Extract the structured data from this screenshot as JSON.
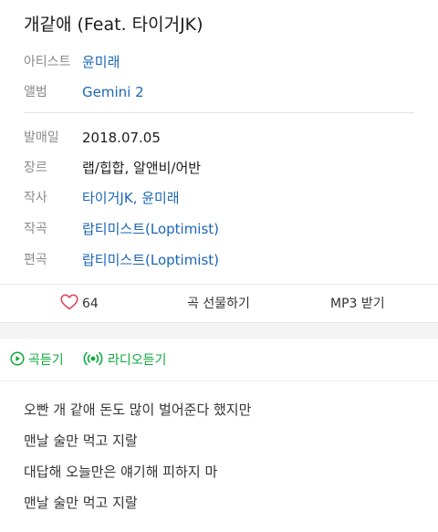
{
  "song": {
    "title": "개같애 (Feat. 타이거JK)"
  },
  "info": [
    {
      "label": "아티스트",
      "value": "윤미래",
      "link": true
    },
    {
      "label": "앨범",
      "value": "Gemini 2",
      "link": true
    },
    {
      "label": "발매일",
      "value": "2018.07.05",
      "link": false
    },
    {
      "label": "장르",
      "value": "랩/힙합, 알앤비/어반",
      "link": false
    },
    {
      "label": "작사",
      "value": "타이거JK, 윤미래",
      "link": true
    },
    {
      "label": "작곡",
      "value": "랍티미스트(Loptimist)",
      "link": true
    },
    {
      "label": "편곡",
      "value": "랍티미스트(Loptimist)",
      "link": true
    }
  ],
  "actions": {
    "like_count": "64",
    "gift_label": "곡 선물하기",
    "mp3_label": "MP3 받기"
  },
  "play": {
    "song_label": "곡듣기",
    "radio_label": "라디오듣기"
  },
  "lyrics": [
    "오빤 개 같애 돈도 많이 벌어준다 했지만",
    "맨날 술만 먹고 지랄",
    "대답해 오늘만은 얘기해 피하지 마",
    "맨날 술만 먹고 지랄"
  ],
  "colors": {
    "link": "#1a66b6",
    "accent_green": "#11a840",
    "heart": "#e0465a",
    "label_gray": "#8a8a8a"
  },
  "icons": {
    "like": "heart-outline-icon",
    "song_play": "play-circle-icon",
    "radio": "radio-broadcast-icon"
  }
}
